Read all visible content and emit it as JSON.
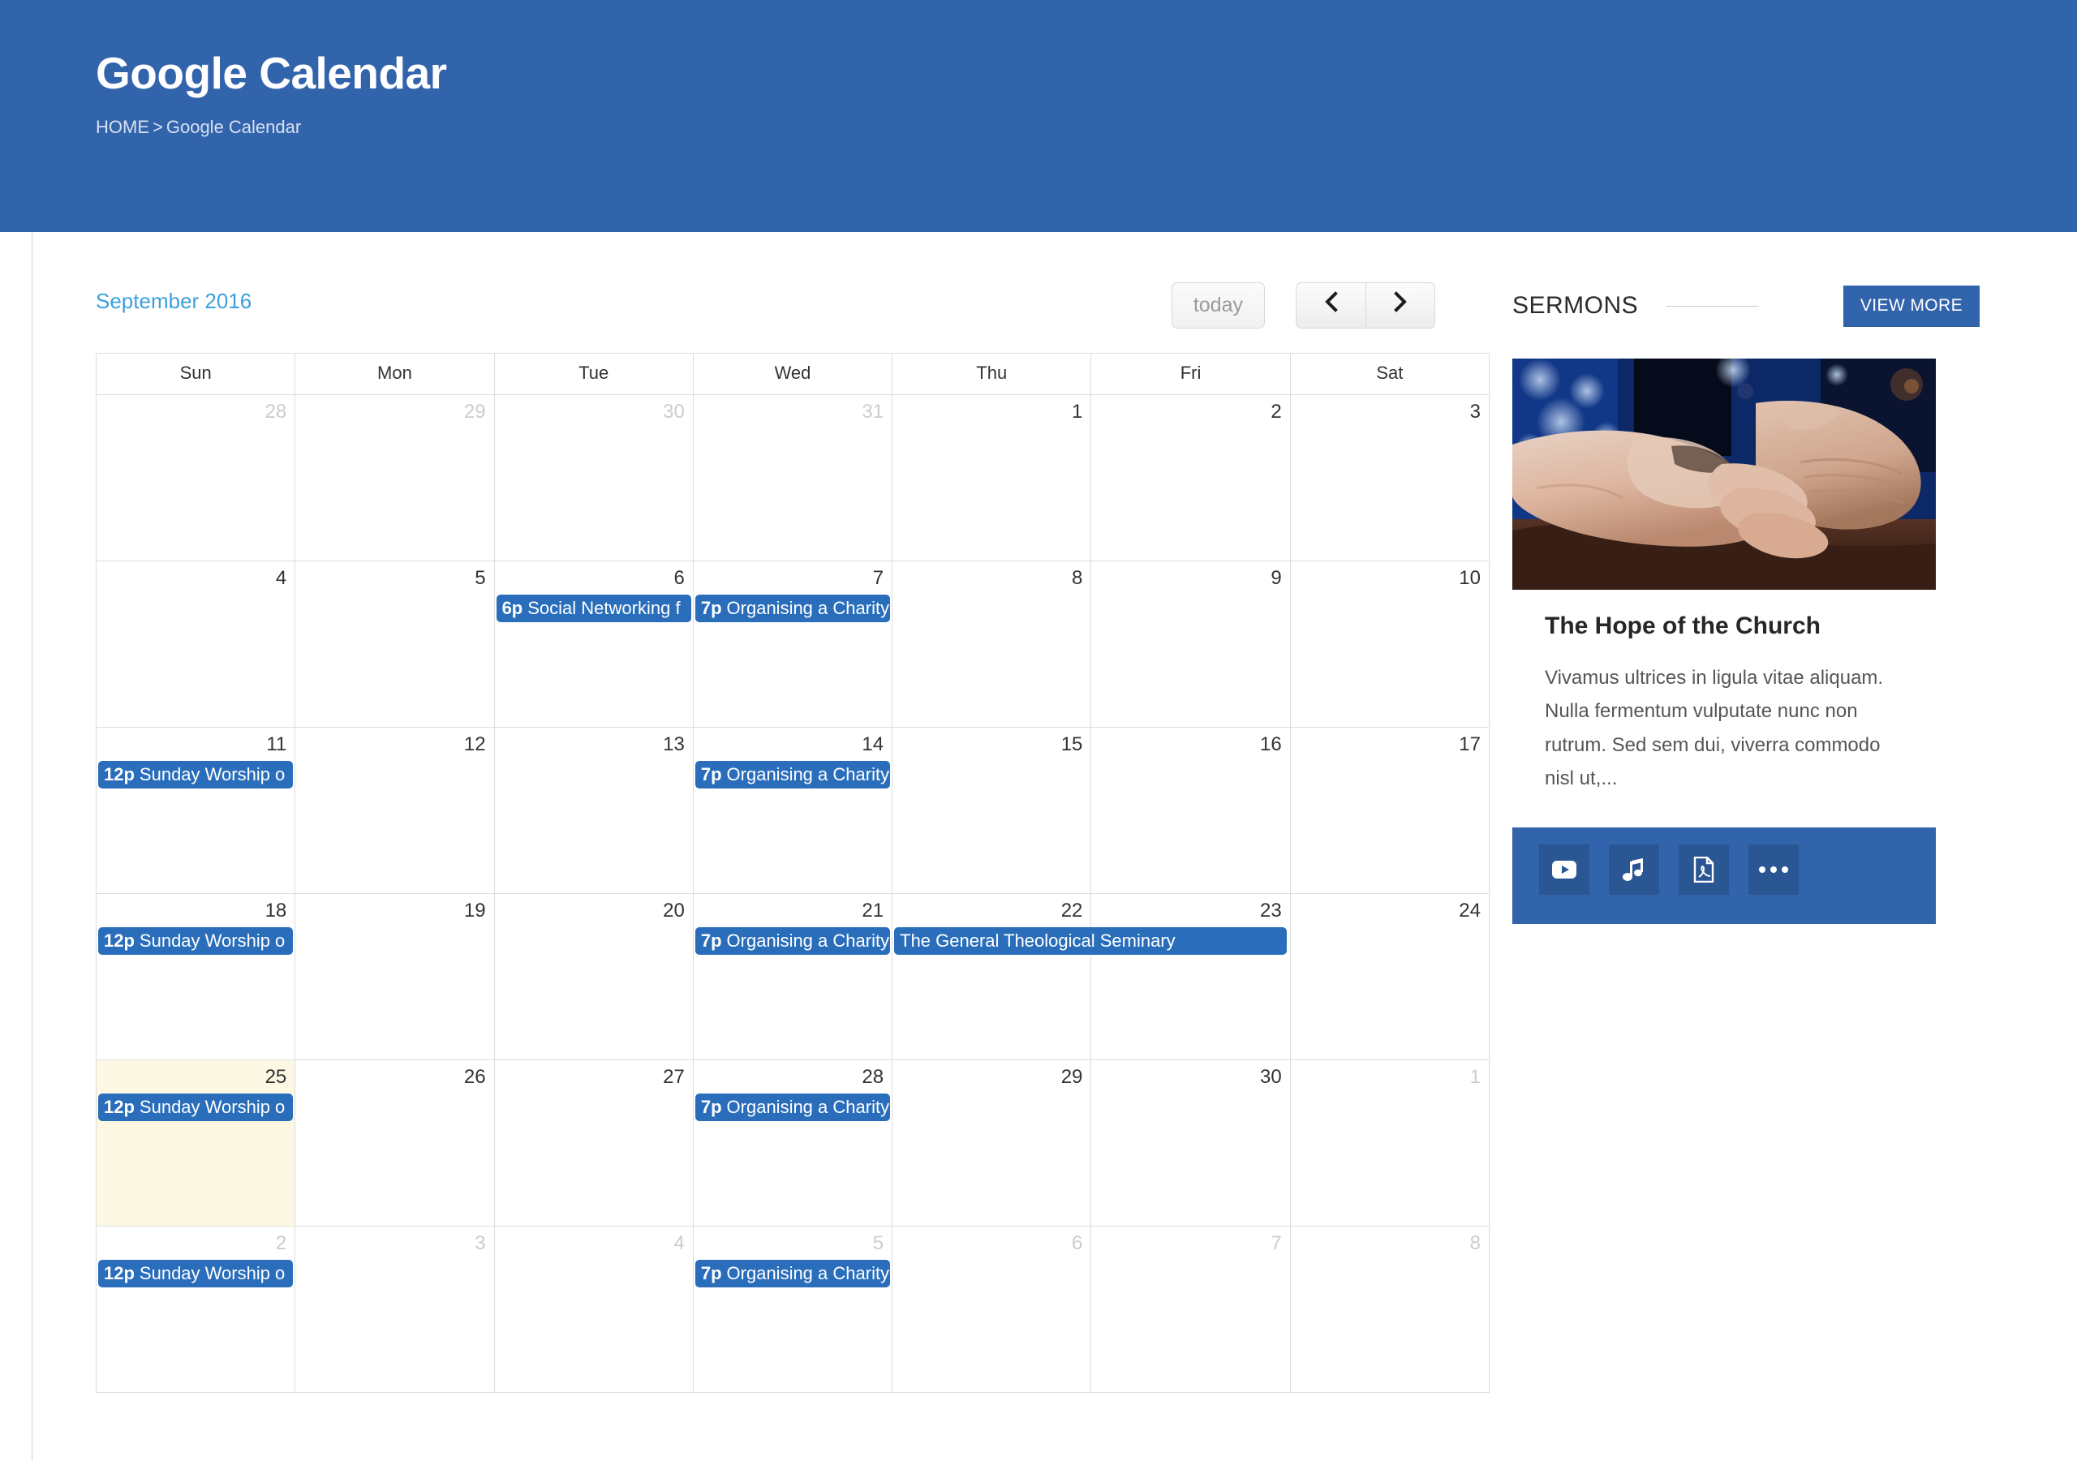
{
  "banner": {
    "title": "Google Calendar",
    "breadcrumb": {
      "home": "HOME",
      "separator": ">",
      "current": "Google Calendar"
    },
    "background_color": "#3264AC"
  },
  "calendar": {
    "title": "September 2016",
    "title_color": "#3BA0DD",
    "toolbar": {
      "today_label": "today",
      "prev_icon": "chevron-left-icon",
      "next_icon": "chevron-right-icon",
      "prev_label": "‹",
      "next_label": "›"
    },
    "day_headers": [
      "Sun",
      "Mon",
      "Tue",
      "Wed",
      "Thu",
      "Fri",
      "Sat"
    ],
    "event_color": "#2A6EBB",
    "today_cell_color": "#FCF8E3",
    "weeks": [
      {
        "days": [
          {
            "num": "28",
            "other_month": true,
            "events": []
          },
          {
            "num": "29",
            "other_month": true,
            "events": []
          },
          {
            "num": "30",
            "other_month": true,
            "events": []
          },
          {
            "num": "31",
            "other_month": true,
            "events": []
          },
          {
            "num": "1",
            "other_month": false,
            "events": []
          },
          {
            "num": "2",
            "other_month": false,
            "events": []
          },
          {
            "num": "3",
            "other_month": false,
            "events": []
          }
        ]
      },
      {
        "days": [
          {
            "num": "4",
            "other_month": false,
            "events": []
          },
          {
            "num": "5",
            "other_month": false,
            "events": []
          },
          {
            "num": "6",
            "other_month": false,
            "events": [
              {
                "time": "6p",
                "title": "Social Networking f",
                "span": 1
              }
            ]
          },
          {
            "num": "7",
            "other_month": false,
            "events": [
              {
                "time": "7p",
                "title": "Organising a Charity",
                "span": 1
              }
            ]
          },
          {
            "num": "8",
            "other_month": false,
            "events": []
          },
          {
            "num": "9",
            "other_month": false,
            "events": []
          },
          {
            "num": "10",
            "other_month": false,
            "events": []
          }
        ]
      },
      {
        "days": [
          {
            "num": "11",
            "other_month": false,
            "events": [
              {
                "time": "12p",
                "title": "Sunday Worship o",
                "span": 1
              }
            ]
          },
          {
            "num": "12",
            "other_month": false,
            "events": []
          },
          {
            "num": "13",
            "other_month": false,
            "events": []
          },
          {
            "num": "14",
            "other_month": false,
            "events": [
              {
                "time": "7p",
                "title": "Organising a Charity",
                "span": 1
              }
            ]
          },
          {
            "num": "15",
            "other_month": false,
            "events": []
          },
          {
            "num": "16",
            "other_month": false,
            "events": []
          },
          {
            "num": "17",
            "other_month": false,
            "events": []
          }
        ]
      },
      {
        "days": [
          {
            "num": "18",
            "other_month": false,
            "events": [
              {
                "time": "12p",
                "title": "Sunday Worship o",
                "span": 1
              }
            ]
          },
          {
            "num": "19",
            "other_month": false,
            "events": []
          },
          {
            "num": "20",
            "other_month": false,
            "events": []
          },
          {
            "num": "21",
            "other_month": false,
            "events": [
              {
                "time": "7p",
                "title": "Organising a Charity",
                "span": 1
              }
            ]
          },
          {
            "num": "22",
            "other_month": false,
            "events": [
              {
                "time": "",
                "title": "The General Theological Seminary",
                "span": 2
              }
            ]
          },
          {
            "num": "23",
            "other_month": false,
            "events": []
          },
          {
            "num": "24",
            "other_month": false,
            "events": []
          }
        ]
      },
      {
        "days": [
          {
            "num": "25",
            "other_month": false,
            "today": true,
            "events": [
              {
                "time": "12p",
                "title": "Sunday Worship o",
                "span": 1
              }
            ]
          },
          {
            "num": "26",
            "other_month": false,
            "events": []
          },
          {
            "num": "27",
            "other_month": false,
            "events": []
          },
          {
            "num": "28",
            "other_month": false,
            "events": [
              {
                "time": "7p",
                "title": "Organising a Charity",
                "span": 1
              }
            ]
          },
          {
            "num": "29",
            "other_month": false,
            "events": []
          },
          {
            "num": "30",
            "other_month": false,
            "events": []
          },
          {
            "num": "1",
            "other_month": true,
            "events": []
          }
        ]
      },
      {
        "days": [
          {
            "num": "2",
            "other_month": true,
            "events": [
              {
                "time": "12p",
                "title": "Sunday Worship o",
                "span": 1
              }
            ]
          },
          {
            "num": "3",
            "other_month": true,
            "events": []
          },
          {
            "num": "4",
            "other_month": true,
            "events": []
          },
          {
            "num": "5",
            "other_month": true,
            "events": [
              {
                "time": "7p",
                "title": "Organising a Charity",
                "span": 1
              }
            ]
          },
          {
            "num": "6",
            "other_month": true,
            "events": []
          },
          {
            "num": "7",
            "other_month": true,
            "events": []
          },
          {
            "num": "8",
            "other_month": true,
            "events": []
          }
        ]
      }
    ]
  },
  "sermons": {
    "heading": "SERMONS",
    "view_more_label": "VIEW MORE",
    "accent_color": "#3264AC",
    "card": {
      "thumb_alt": "hands-holding-photo",
      "title": "The Hope of the Church",
      "excerpt": "Vivamus ultrices in ligula vitae aliquam. Nulla fermentum vulputate nunc non rutrum. Sed sem dui, viverra commodo nisl ut,...",
      "actions": [
        {
          "icon": "video-play-icon",
          "name": "watch-video-button"
        },
        {
          "icon": "music-note-icon",
          "name": "listen-audio-button"
        },
        {
          "icon": "pdf-file-icon",
          "name": "download-pdf-button"
        },
        {
          "icon": "ellipsis-icon",
          "name": "more-options-button"
        }
      ]
    }
  }
}
